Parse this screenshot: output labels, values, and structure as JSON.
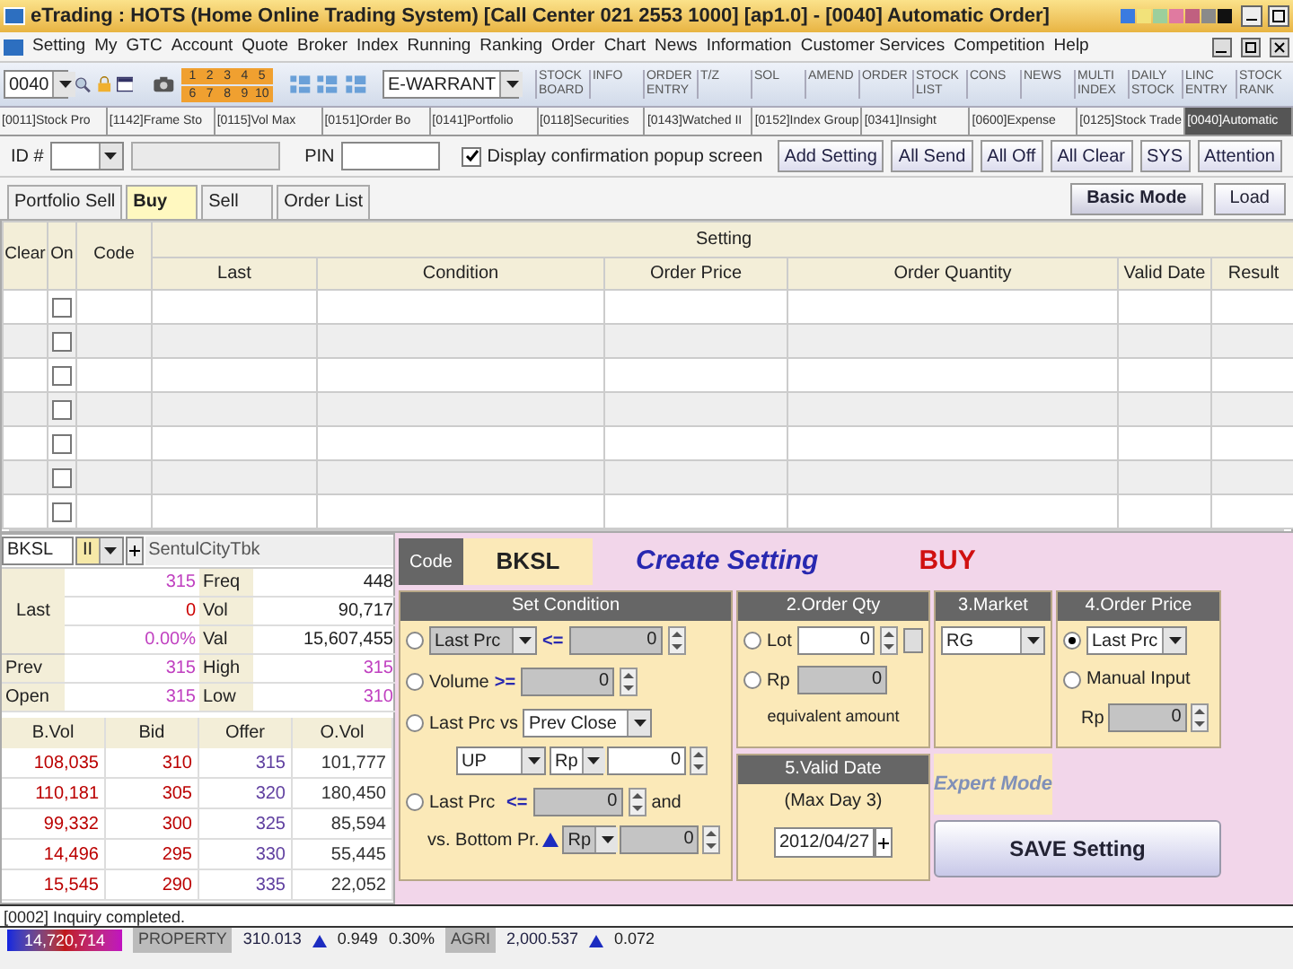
{
  "window": {
    "title": "eTrading : HOTS (Home Online Trading System) [Call Center 021 2553 1000] [ap1.0] - [0040] Automatic Order]"
  },
  "menu": [
    "Setting",
    "My",
    "GTC",
    "Account",
    "Quote",
    "Broker",
    "Index",
    "Running",
    "Ranking",
    "Order",
    "Chart",
    "News",
    "Information",
    "Customer Services",
    "Competition",
    "Help"
  ],
  "toolbar": {
    "screen_number": "0040",
    "layout_buttons": [
      "1",
      "2",
      "3",
      "4",
      "5",
      "6",
      "7",
      "8",
      "9",
      "10"
    ],
    "market_select": "E-WARRANT",
    "shortcuts": [
      "STOCK BOARD",
      "INFO",
      "ORDER ENTRY",
      "T/Z",
      "SOL",
      "AMEND",
      "ORDER",
      "STOCK LIST",
      "CONS",
      "NEWS",
      "MULTI INDEX",
      "DAILY STOCK",
      "LINC ENTRY",
      "STOCK RANK"
    ]
  },
  "screen_tabs": [
    {
      "label": "[0011]Stock Pro",
      "selected": false
    },
    {
      "label": "[1142]Frame Sto",
      "selected": false
    },
    {
      "label": "[0115]Vol Max",
      "selected": false
    },
    {
      "label": "[0151]Order Bo",
      "selected": false
    },
    {
      "label": "[0141]Portfolio",
      "selected": false
    },
    {
      "label": "[0118]Securities",
      "selected": false
    },
    {
      "label": "[0143]Watched II",
      "selected": false
    },
    {
      "label": "[0152]Index Group",
      "selected": false
    },
    {
      "label": "[0341]Insight",
      "selected": false
    },
    {
      "label": "[0600]Expense",
      "selected": false
    },
    {
      "label": "[0125]Stock Trade",
      "selected": false
    },
    {
      "label": "[0040]Automatic",
      "selected": true
    }
  ],
  "order_form": {
    "id_label": "ID #",
    "pin_label": "PIN",
    "confirm": {
      "label": "Display confirmation popup screen",
      "checked": true
    },
    "buttons": [
      "Add Setting",
      "All Send",
      "All Off",
      "All Clear",
      "SYS",
      "Attention"
    ]
  },
  "mode_tabs": [
    {
      "label": "Portfolio Sell",
      "selected": false
    },
    {
      "label": "Buy",
      "selected": true
    },
    {
      "label": "Sell",
      "selected": false
    },
    {
      "label": "Order List",
      "selected": false
    }
  ],
  "mode_buttons": [
    "Basic Mode",
    "Load"
  ],
  "table": {
    "group": "Setting",
    "columns": [
      "Clear",
      "On",
      "Code",
      "Last",
      "Condition",
      "Order Price",
      "Order Quantity",
      "Valid Date",
      "Result"
    ],
    "rows": [
      {
        "on": false
      },
      {
        "on": false
      },
      {
        "on": false
      },
      {
        "on": false
      },
      {
        "on": false
      },
      {
        "on": false
      },
      {
        "on": false
      }
    ]
  },
  "quote": {
    "code": "BKSL",
    "board": "II",
    "name": "SentulCityTbk",
    "last": {
      "label": "Last",
      "price": "315",
      "change": "0",
      "percent": "0.00%"
    },
    "stats": [
      {
        "label": "Freq",
        "value": "448"
      },
      {
        "label": "Vol",
        "value": "90,717"
      },
      {
        "label": "Val",
        "value": "15,607,455"
      },
      {
        "label": "High",
        "value": "315"
      },
      {
        "label": "Low",
        "value": "310"
      }
    ],
    "prev": {
      "label": "Prev",
      "value": "315"
    },
    "open": {
      "label": "Open",
      "value": "315"
    },
    "book": {
      "columns": [
        "B.Vol",
        "Bid",
        "Offer",
        "O.Vol"
      ],
      "rows": [
        [
          "108,035",
          "310",
          "315",
          "101,777"
        ],
        [
          "110,181",
          "305",
          "320",
          "180,450"
        ],
        [
          "99,332",
          "300",
          "325",
          "85,594"
        ],
        [
          "14,496",
          "295",
          "330",
          "55,445"
        ],
        [
          "15,545",
          "290",
          "335",
          "22,052"
        ]
      ]
    }
  },
  "setting": {
    "code_label": "Code",
    "code": "BKSL",
    "title": "Create Setting",
    "side": "BUY",
    "condition": {
      "title": "Set Condition",
      "rows": [
        {
          "kind": "select_compare",
          "selected": false,
          "field": "Last Prc",
          "operator": "<=",
          "value": "0"
        },
        {
          "kind": "compare",
          "selected": false,
          "field": "Volume",
          "operator": ">=",
          "value": "0"
        },
        {
          "kind": "versus",
          "selected": false,
          "label": "Last Prc vs",
          "reference": "Prev Close",
          "direction": "UP",
          "unit": "Rp",
          "value": "0"
        },
        {
          "kind": "bottom",
          "selected": false,
          "label": "Last Prc",
          "operator": "<=",
          "value": "0",
          "suffix": "and",
          "vs_label": "vs. Bottom Pr.",
          "unit": "Rp",
          "value2": "0"
        }
      ]
    },
    "quantity": {
      "title": "2.Order Qty",
      "options": [
        {
          "label": "Lot",
          "value": "0",
          "selected": false
        },
        {
          "label": "Rp",
          "value": "0",
          "selected": false
        }
      ],
      "note": "equivalent amount"
    },
    "market": {
      "title": "3.Market",
      "value": "RG"
    },
    "price": {
      "title": "4.Order Price",
      "options": [
        {
          "label": "Last Prc",
          "selected": true
        },
        {
          "label": "Manual Input",
          "selected": false
        }
      ],
      "unit": "Rp",
      "value": "0"
    },
    "valid": {
      "title": "5.Valid Date",
      "note": "(Max Day 3)",
      "date": "2012/04/27"
    },
    "expert": "Expert Mode",
    "save": "SAVE Setting"
  },
  "status_bar": "[0002] Inquiry completed.",
  "ticker": [
    {
      "kind": "total",
      "value": "14,720,714"
    },
    {
      "kind": "sector",
      "name": "PROPERTY",
      "index": "310.013",
      "up": true,
      "change": "0.949",
      "percent": "0.30%"
    },
    {
      "kind": "sector",
      "name": "AGRI",
      "index": "2,000.537",
      "up": true,
      "change": "0.072"
    }
  ]
}
